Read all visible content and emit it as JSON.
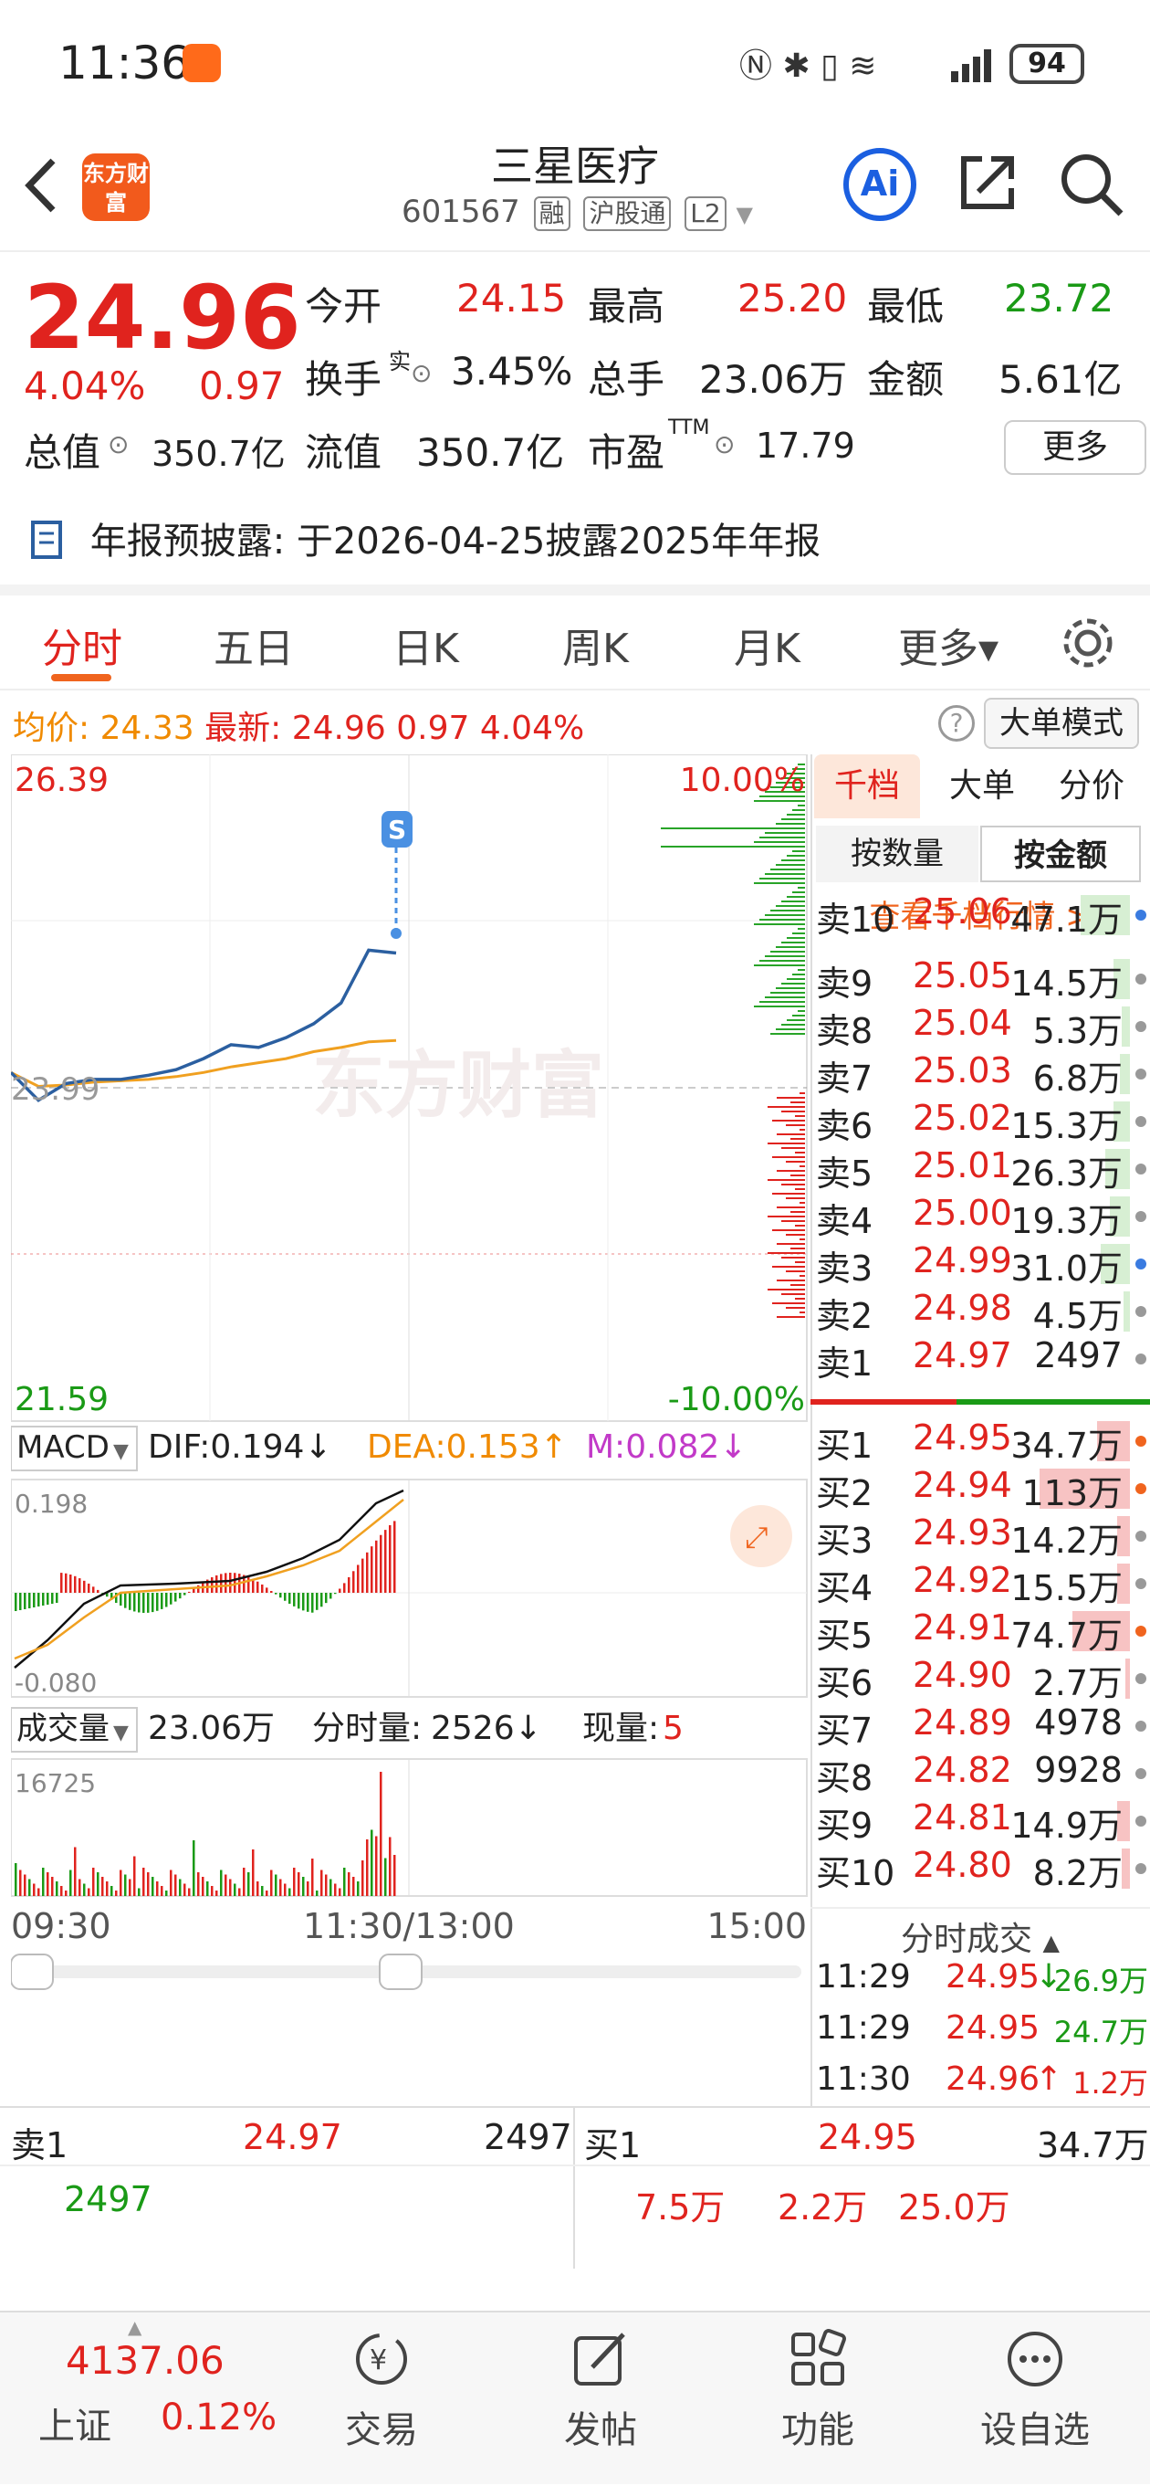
{
  "status": {
    "time": "11:36",
    "battery": "94"
  },
  "header": {
    "back_icon": "chevron-left-icon",
    "logo_text": "东方财富",
    "stock_name": "三星医疗",
    "stock_code": "601567",
    "tags": [
      "融",
      "沪股通",
      "L2"
    ],
    "ai_label": "Ai"
  },
  "quote": {
    "price": "24.96",
    "change_pct": "4.04%",
    "change": "0.97",
    "open_label": "今开",
    "open": "24.15",
    "high_label": "最高",
    "high": "25.20",
    "low_label": "最低",
    "low": "23.72",
    "turnover_label": "换手",
    "turnover_sup": "实",
    "turnover": "3.45%",
    "vol_label": "总手",
    "vol": "23.06万",
    "amount_label": "金额",
    "amount": "5.61亿",
    "mktcap_label": "总值",
    "mktcap": "350.7亿",
    "float_label": "流值",
    "float": "350.7亿",
    "pe_label": "市盈",
    "pe_sup": "TTM",
    "pe": "17.79",
    "more_label": "更多"
  },
  "notice": {
    "label": "年报预披露:",
    "text": "于2026-04-25披露2025年年报"
  },
  "tabs": [
    {
      "label": "分时",
      "active": true
    },
    {
      "label": "五日"
    },
    {
      "label": "日K"
    },
    {
      "label": "周K"
    },
    {
      "label": "月K"
    },
    {
      "label": "更多▾"
    }
  ],
  "infoline": {
    "avg_label": "均价:",
    "avg": "24.33",
    "latest_label": "最新:",
    "latest": "24.96",
    "chg": "0.97",
    "pct": "4.04%",
    "bigmode_label": "大单模式"
  },
  "chart": {
    "y_top": "26.39",
    "y_bottom": "21.59",
    "pct_top": "10.00%",
    "pct_bottom": "-10.00%",
    "ref_line": "23.99",
    "watermark": "东方财富",
    "signal": "S",
    "macd": {
      "label": "MACD",
      "dif": "DIF:0.194↓",
      "dea": "DEA:0.153↑",
      "m": "M:0.082↓",
      "top": "0.198",
      "bottom": "-0.080"
    },
    "volume": {
      "label": "成交量",
      "total": "23.06万",
      "tick_label": "分时量:",
      "tick": "2526↓",
      "now_label": "现量:",
      "now": "5",
      "top": "16725"
    },
    "time_labels": [
      "09:30",
      "11:30/13:00",
      "15:00"
    ]
  },
  "chart_data": {
    "type": "line",
    "title": "",
    "x": [
      "09:30",
      "09:40",
      "09:50",
      "10:00",
      "10:10",
      "10:20",
      "10:30",
      "10:40",
      "10:50",
      "11:00",
      "11:10",
      "11:20",
      "11:25",
      "11:29",
      "11:30"
    ],
    "series": [
      {
        "name": "",
        "values": [
          24.1,
          23.9,
          24.02,
          24.05,
          24.05,
          24.08,
          24.12,
          24.2,
          24.3,
          24.28,
          24.35,
          24.45,
          24.6,
          24.98,
          24.96
        ]
      },
      {
        "name": "均价",
        "values": [
          24.1,
          24.0,
          24.01,
          24.03,
          24.04,
          24.05,
          24.07,
          24.1,
          24.14,
          24.17,
          24.2,
          24.25,
          24.28,
          24.32,
          24.33
        ]
      }
    ],
    "ylim": [
      21.59,
      26.39
    ],
    "y2label": "",
    "color_price": "#2b5fa0",
    "color_avg": "#f0a020"
  },
  "orderbook": {
    "tabs": [
      "千档",
      "大单",
      "分价"
    ],
    "seg": [
      "按数量",
      "按金额"
    ],
    "link": "查看千档行情 >",
    "sells": [
      {
        "label": "卖10",
        "price": "25.06",
        "vol": "47.1万",
        "dot": "blue",
        "bar": 0.3
      },
      {
        "label": "卖9",
        "price": "25.05",
        "vol": "14.5万",
        "dot": "gray",
        "bar": 0.1
      },
      {
        "label": "卖8",
        "price": "25.04",
        "vol": "5.3万",
        "dot": "gray",
        "bar": 0.05
      },
      {
        "label": "卖7",
        "price": "25.03",
        "vol": "6.8万",
        "dot": "gray",
        "bar": 0.06
      },
      {
        "label": "卖6",
        "price": "25.02",
        "vol": "15.3万",
        "dot": "gray",
        "bar": 0.1
      },
      {
        "label": "卖5",
        "price": "25.01",
        "vol": "26.3万",
        "dot": "gray",
        "bar": 0.15
      },
      {
        "label": "卖4",
        "price": "25.00",
        "vol": "19.3万",
        "dot": "gray",
        "bar": 0.12
      },
      {
        "label": "卖3",
        "price": "24.99",
        "vol": "31.0万",
        "dot": "blue",
        "bar": 0.18
      },
      {
        "label": "卖2",
        "price": "24.98",
        "vol": "4.5万",
        "dot": "gray",
        "bar": 0.04
      },
      {
        "label": "卖1",
        "price": "24.97",
        "vol": "2497",
        "dot": "gray",
        "bar": 0.0
      }
    ],
    "buys": [
      {
        "label": "买1",
        "price": "24.95",
        "vol": "34.7万",
        "dot": "orange",
        "bar": 0.2
      },
      {
        "label": "买2",
        "price": "24.94",
        "vol": "113万",
        "dot": "orange",
        "bar": 0.55
      },
      {
        "label": "买3",
        "price": "24.93",
        "vol": "14.2万",
        "dot": "gray",
        "bar": 0.08
      },
      {
        "label": "买4",
        "price": "24.92",
        "vol": "15.5万",
        "dot": "gray",
        "bar": 0.08
      },
      {
        "label": "买5",
        "price": "24.91",
        "vol": "74.7万",
        "dot": "orange",
        "bar": 0.35
      },
      {
        "label": "买6",
        "price": "24.90",
        "vol": "2.7万",
        "dot": "gray",
        "bar": 0.03
      },
      {
        "label": "买7",
        "price": "24.89",
        "vol": "4978",
        "dot": "gray",
        "bar": 0.0
      },
      {
        "label": "买8",
        "price": "24.82",
        "vol": "9928",
        "dot": "gray",
        "bar": 0.0
      },
      {
        "label": "买9",
        "price": "24.81",
        "vol": "14.9万",
        "dot": "gray",
        "bar": 0.08
      },
      {
        "label": "买10",
        "price": "24.80",
        "vol": "8.2万",
        "dot": "gray",
        "bar": 0.05
      }
    ],
    "ticks_title": "分时成交",
    "ticks": [
      {
        "time": "11:29",
        "price": "24.95",
        "arrow": "↓",
        "vol": "26.9万",
        "color": "green"
      },
      {
        "time": "11:29",
        "price": "24.95",
        "arrow": "",
        "vol": "24.7万",
        "color": "green"
      },
      {
        "time": "11:30",
        "price": "24.96",
        "arrow": "↑",
        "vol": "1.2万",
        "color": "red"
      }
    ]
  },
  "bottom": {
    "sell_label": "卖1",
    "sell_price": "24.97",
    "sell_vol": "2497",
    "sell_detail": "2497",
    "buy_label": "买1",
    "buy_price": "24.95",
    "buy_vol": "34.7万",
    "buy_details": [
      "7.5万",
      "2.2万",
      "25.0万"
    ]
  },
  "nav": {
    "index_value": "4137.06",
    "index_name": "上证",
    "index_pct": "0.12%",
    "items": [
      {
        "label": "交易",
        "icon": "yen-cycle-icon"
      },
      {
        "label": "发帖",
        "icon": "edit-icon"
      },
      {
        "label": "功能",
        "icon": "grid-icon"
      },
      {
        "label": "设自选",
        "icon": "more-circle-icon"
      }
    ]
  }
}
